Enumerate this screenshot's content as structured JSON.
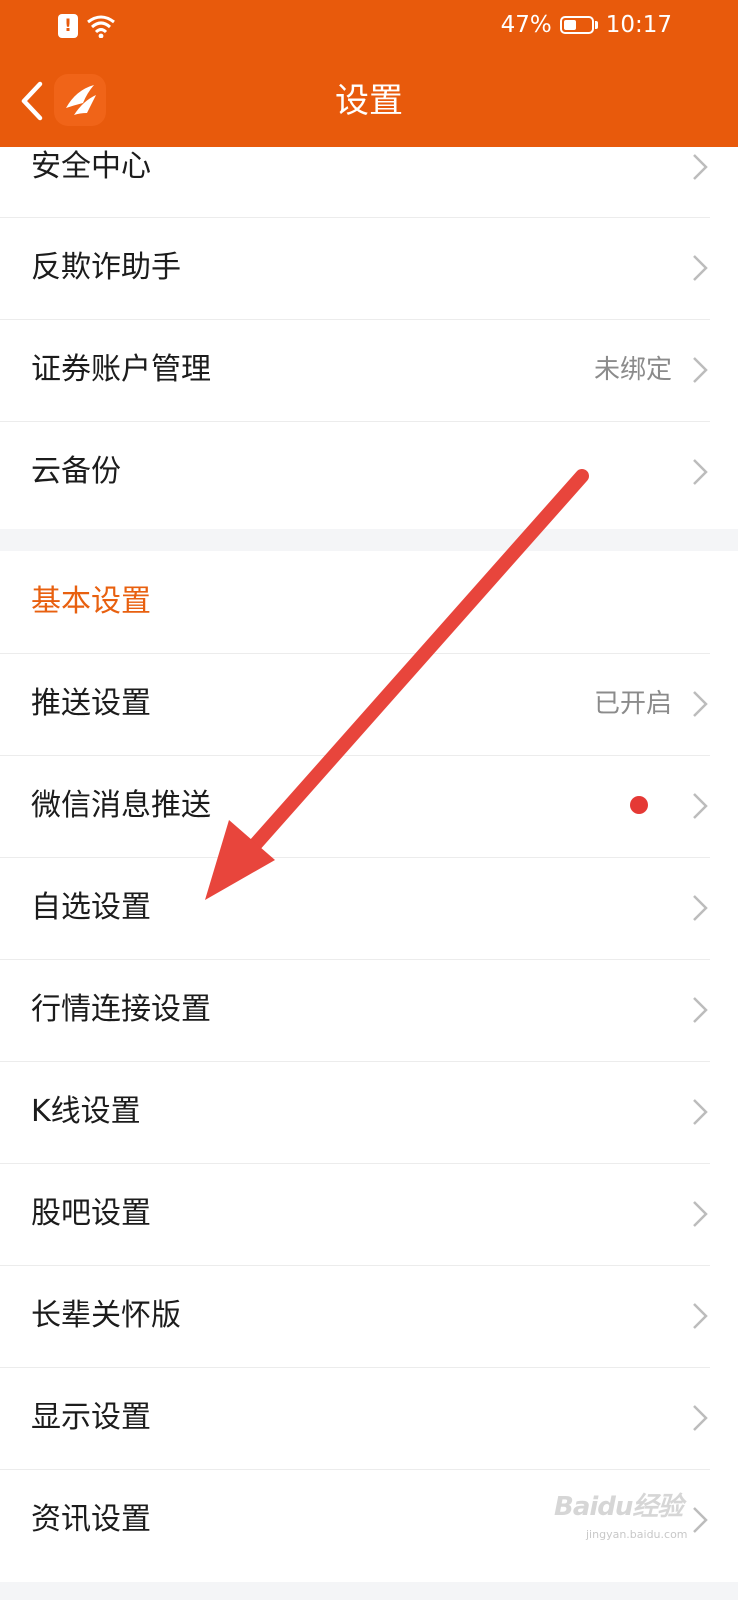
{
  "status_bar": {
    "battery": "47%",
    "time": "10:17"
  },
  "nav": {
    "title": "设置"
  },
  "section1": {
    "items": [
      {
        "label": "安全中心",
        "value": ""
      },
      {
        "label": "反欺诈助手",
        "value": ""
      },
      {
        "label": "证券账户管理",
        "value": "未绑定"
      },
      {
        "label": "云备份",
        "value": ""
      }
    ]
  },
  "section2": {
    "header": "基本设置",
    "items": [
      {
        "label": "推送设置",
        "value": "已开启"
      },
      {
        "label": "微信消息推送",
        "value": ""
      },
      {
        "label": "自选设置",
        "value": ""
      },
      {
        "label": "行情连接设置",
        "value": ""
      },
      {
        "label": "K线设置",
        "value": ""
      },
      {
        "label": "股吧设置",
        "value": ""
      },
      {
        "label": "长辈关怀版",
        "value": ""
      },
      {
        "label": "显示设置",
        "value": ""
      },
      {
        "label": "资讯设置",
        "value": ""
      }
    ]
  },
  "watermark": {
    "text": "Baidu经验",
    "sub": "jingyan.baidu.com"
  },
  "colors": {
    "header": "#e85a0c",
    "accent": "#e8600f",
    "arrow": "#e8453c",
    "dot": "#e53935"
  },
  "icons": {
    "back": "chevron-left-icon",
    "chevron": "chevron-right-icon",
    "alert": "alert-icon",
    "wifi": "wifi-icon",
    "battery": "battery-icon"
  }
}
